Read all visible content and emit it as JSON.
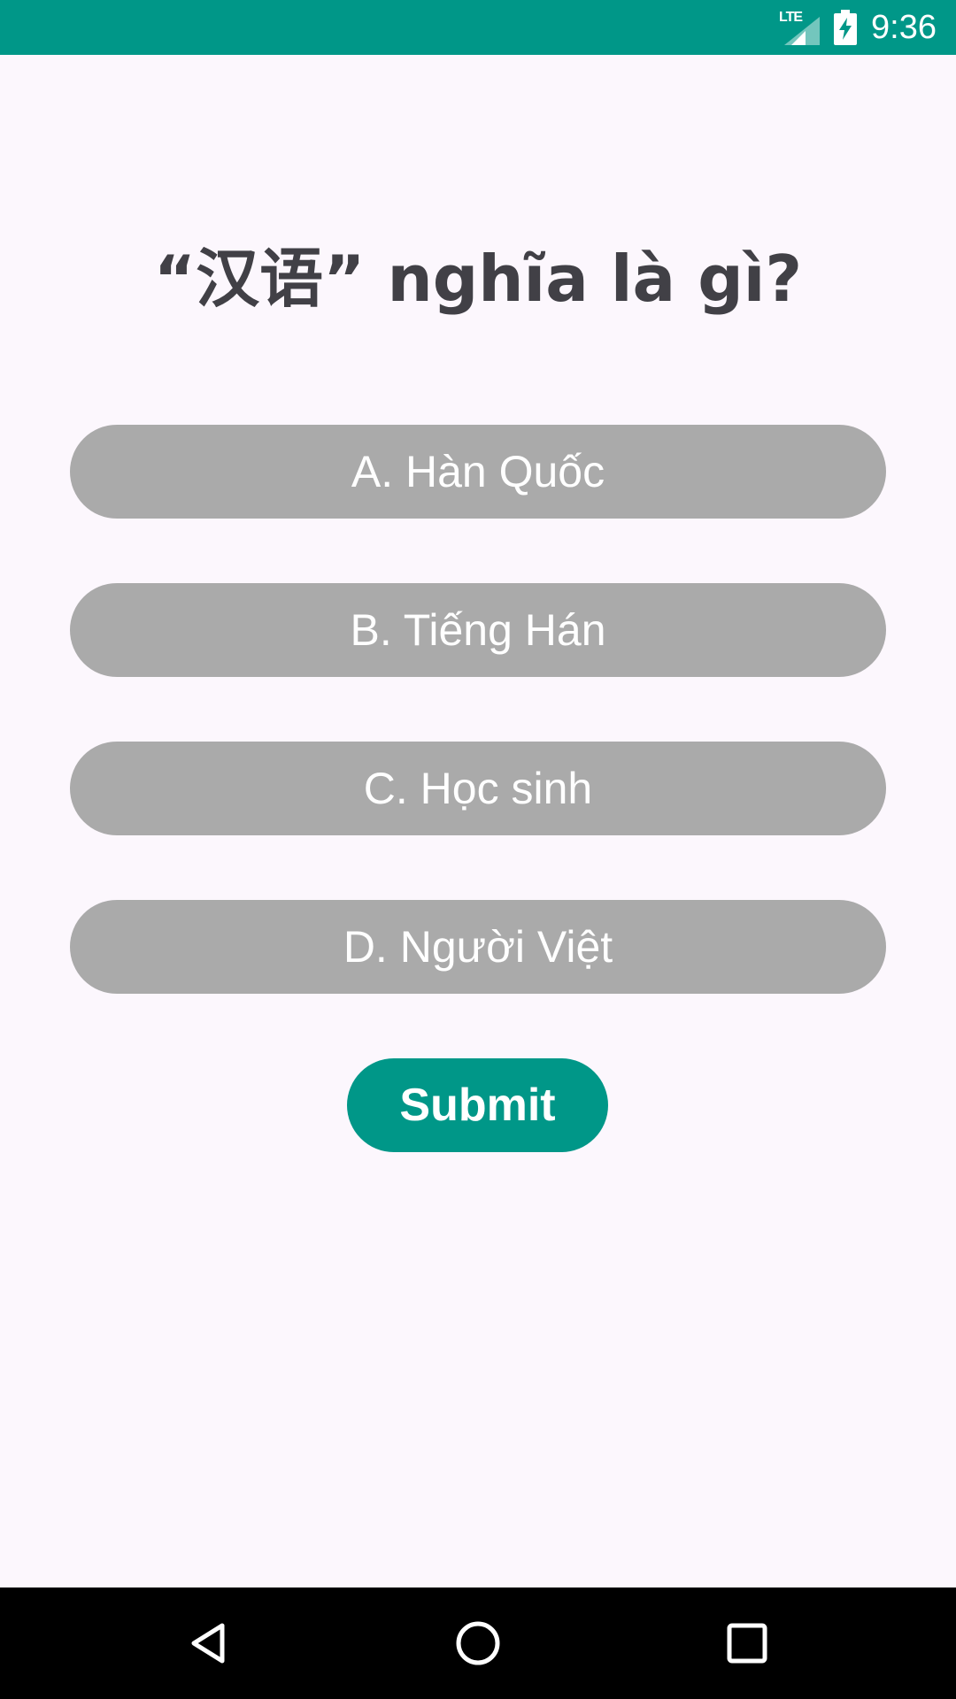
{
  "status_bar": {
    "network_label": "LTE",
    "time": "9:36",
    "background": "#009788",
    "icons": [
      "lte-signal-icon",
      "battery-charging-icon"
    ]
  },
  "question": {
    "text": "“汉语” nghĩa là gì?"
  },
  "options": [
    {
      "label": "A. Hàn Quốc"
    },
    {
      "label": "B. Tiếng Hán"
    },
    {
      "label": "C. Học sinh"
    },
    {
      "label": "D. Người Việt"
    }
  ],
  "submit": {
    "label": "Submit"
  },
  "colors": {
    "accent": "#009788",
    "option_background": "#AAAAAA",
    "question_text": "#414046",
    "page_background": "#FCF7FD"
  },
  "nav_bar": {
    "icons": [
      "back-icon",
      "home-icon",
      "recents-icon"
    ]
  }
}
